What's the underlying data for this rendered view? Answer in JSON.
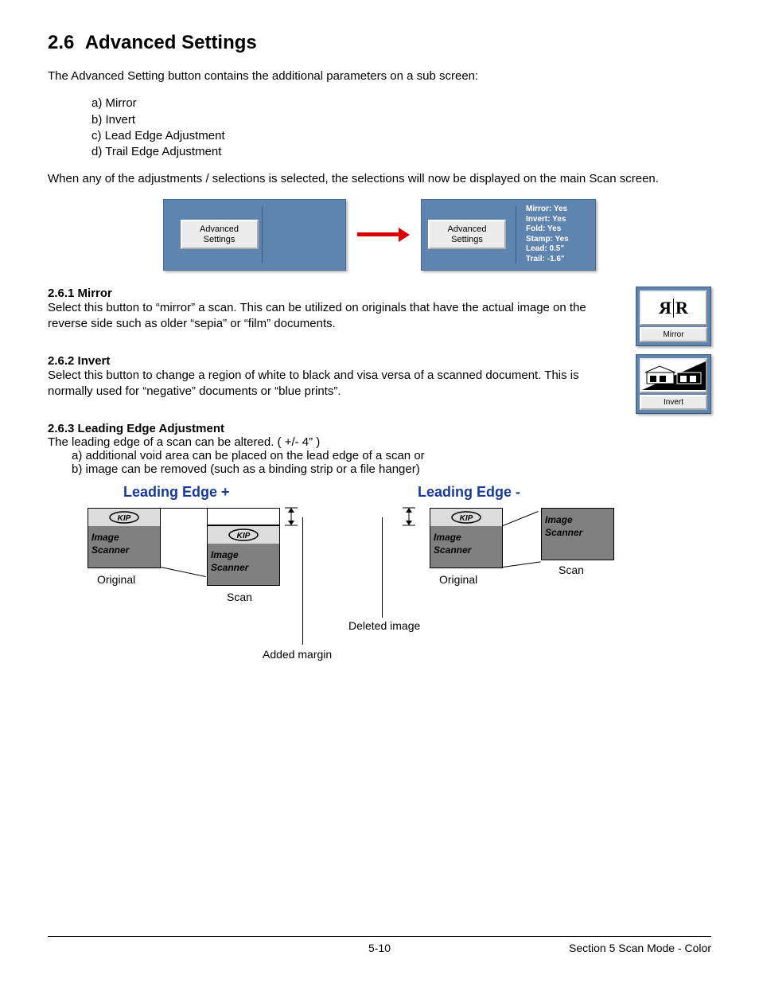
{
  "heading": {
    "num": "2.6",
    "title": "Advanced Settings"
  },
  "intro": "The Advanced Setting button contains the additional parameters on a sub screen:",
  "paramList": [
    "a)  Mirror",
    "b)  Invert",
    "c)  Lead Edge Adjustment",
    "d)  Trail Edge Adjustment"
  ],
  "note": "When any of the adjustments / selections is selected, the selections will now be displayed on the main Scan screen.",
  "panels": {
    "btnLabel": "Advanced Settings",
    "status": [
      "Mirror: Yes",
      "Invert: Yes",
      "Fold: Yes",
      "Stamp: Yes",
      "Lead: 0.5\"",
      "Trail: -1.6\""
    ]
  },
  "sub": {
    "mirror": {
      "hd": "2.6.1   Mirror",
      "body": "Select this button to “mirror” a scan. This can be utilized on originals that have the actual image on the reverse side such as older “sepia” or “film” documents.",
      "iconLabel": "Mirror"
    },
    "invert": {
      "hd": "2.6.2   Invert",
      "body": "Select this button to change a region of white to black and visa versa of a scanned document. This is normally used for “negative” documents or “blue prints”.",
      "iconLabel": "Invert"
    },
    "leading": {
      "hd": "2.6.3   Leading Edge Adjustment",
      "body": "The leading edge of a scan can be altered. ( +/- 4” )",
      "list": [
        "a)  additional void area can be placed on the lead edge of a scan or",
        "b)  image can be removed (such as a binding strip or a file hanger)"
      ]
    }
  },
  "diagram": {
    "title_plus": "Leading Edge +",
    "title_minus": "Leading Edge -",
    "original": "Original",
    "scan": "Scan",
    "added": "Added margin",
    "deleted": "Deleted image",
    "boxText1": "Image",
    "boxText2": "Scanner",
    "logo": "KIP"
  },
  "footer": {
    "page": "5-10",
    "section": "Section 5     Scan Mode - Color"
  }
}
